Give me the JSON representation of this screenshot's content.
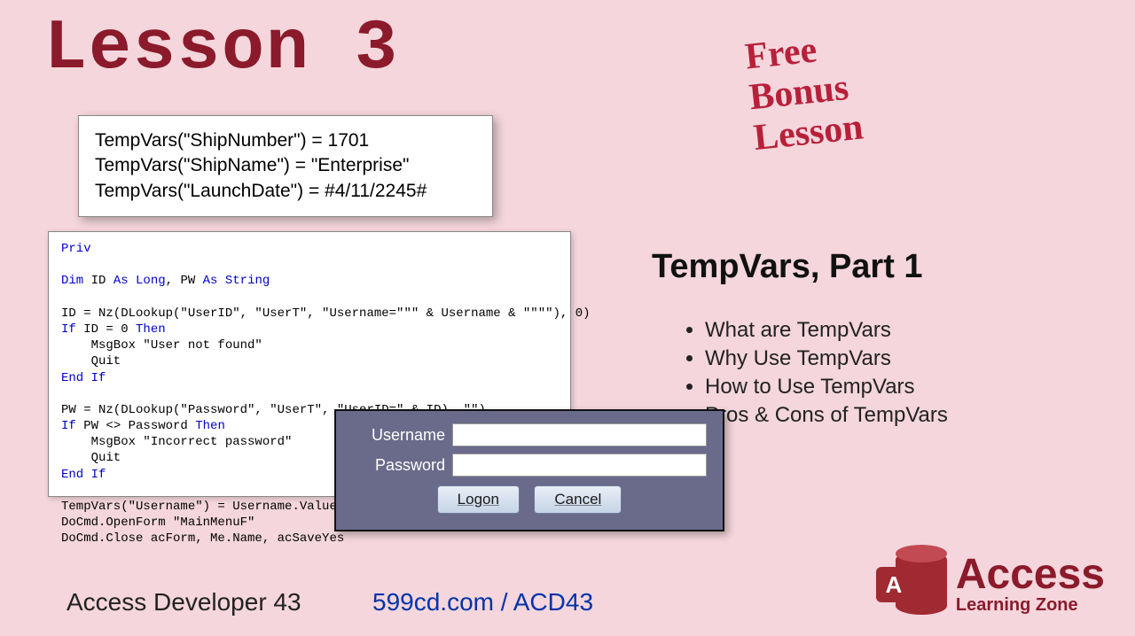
{
  "title": "Lesson 3",
  "bonus": "Free\nBonus\nLesson",
  "snippet": {
    "l1": "TempVars(\"ShipNumber\") = 1701",
    "l2": "TempVars(\"ShipName\") = \"Enterprise\"",
    "l3": "TempVars(\"LaunchDate\") = #4/11/2245#"
  },
  "code_top": "Priv",
  "code_l1a": "Dim",
  "code_l1b": " ID ",
  "code_l1c": "As Long",
  "code_l1d": ", PW ",
  "code_l1e": "As String",
  "code_l2": "ID = Nz(DLookup(\"UserID\", \"UserT\", \"Username=\"\"\" & Username & \"\"\"\"), 0)",
  "code_l3a": "If",
  "code_l3b": " ID = 0 ",
  "code_l3c": "Then",
  "code_l4": "    MsgBox \"User not found\"",
  "code_l5": "    Quit",
  "code_l6": "End If",
  "code_l7": "PW = Nz(DLookup(\"Password\", \"UserT\", \"UserID=\" & ID), \"\")",
  "code_l8a": "If",
  "code_l8b": " PW <> Password ",
  "code_l8c": "Then",
  "code_l9": "    MsgBox \"Incorrect password\"",
  "code_l10": "    Quit",
  "code_l11": "End If",
  "code_l12": "TempVars(\"Username\") = Username.Value",
  "code_l13": "DoCmd.OpenForm \"MainMenuF\"",
  "code_l14": "DoCmd.Close acForm, Me.Name, acSaveYes",
  "login": {
    "username_label": "Username",
    "password_label": "Password",
    "logon": "Logon",
    "cancel": "Cancel"
  },
  "subtitle": "TempVars, Part 1",
  "bullets": [
    "What are TempVars",
    "Why Use TempVars",
    "How to Use TempVars",
    "Pros & Cons of TempVars"
  ],
  "footer_left": "Access Developer 43",
  "footer_mid": "599cd.com / ACD43",
  "logo": {
    "a": "A",
    "big": "Access",
    "small": "Learning Zone"
  }
}
